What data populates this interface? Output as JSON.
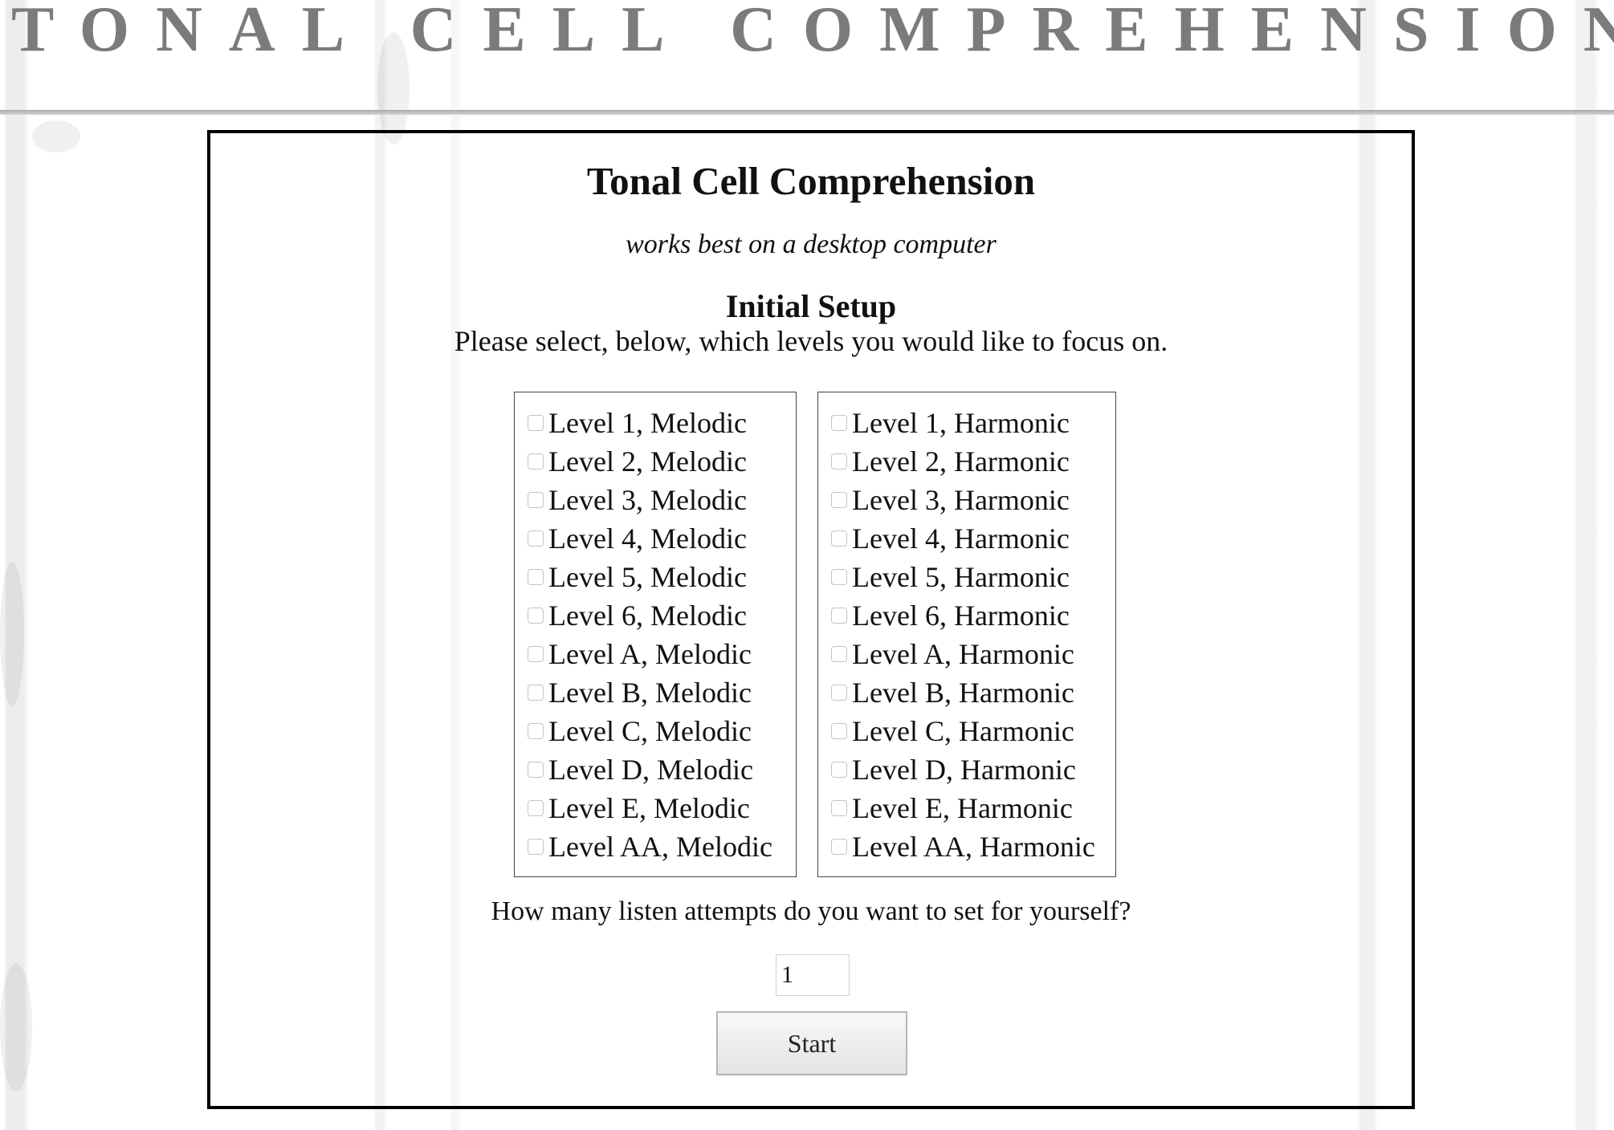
{
  "banner": {
    "title": "TONAL CELL COMPREHENSION"
  },
  "panel": {
    "title": "Tonal Cell Comprehension",
    "subtitle": "works best on a desktop computer",
    "setup_heading": "Initial Setup",
    "instructions": "Please select, below, which levels you would like to focus on."
  },
  "melodic_levels": [
    {
      "label": "Level 1, Melodic",
      "checked": false
    },
    {
      "label": "Level 2, Melodic",
      "checked": false
    },
    {
      "label": "Level 3, Melodic",
      "checked": false
    },
    {
      "label": "Level 4, Melodic",
      "checked": false
    },
    {
      "label": "Level 5, Melodic",
      "checked": false
    },
    {
      "label": "Level 6, Melodic",
      "checked": false
    },
    {
      "label": "Level A, Melodic",
      "checked": false
    },
    {
      "label": "Level B, Melodic",
      "checked": false
    },
    {
      "label": "Level C, Melodic",
      "checked": false
    },
    {
      "label": "Level D, Melodic",
      "checked": false
    },
    {
      "label": "Level E, Melodic",
      "checked": false
    },
    {
      "label": "Level AA, Melodic",
      "checked": false
    }
  ],
  "harmonic_levels": [
    {
      "label": "Level 1, Harmonic",
      "checked": false
    },
    {
      "label": "Level 2, Harmonic",
      "checked": false
    },
    {
      "label": "Level 3, Harmonic",
      "checked": false
    },
    {
      "label": "Level 4, Harmonic",
      "checked": false
    },
    {
      "label": "Level 5, Harmonic",
      "checked": false
    },
    {
      "label": "Level 6, Harmonic",
      "checked": false
    },
    {
      "label": "Level A, Harmonic",
      "checked": false
    },
    {
      "label": "Level B, Harmonic",
      "checked": false
    },
    {
      "label": "Level C, Harmonic",
      "checked": false
    },
    {
      "label": "Level D, Harmonic",
      "checked": false
    },
    {
      "label": "Level E, Harmonic",
      "checked": false
    },
    {
      "label": "Level AA, Harmonic",
      "checked": false
    }
  ],
  "attempts": {
    "question": "How many listen attempts do you want to set for yourself?",
    "value": "1"
  },
  "start_button": {
    "label": "Start"
  },
  "colors": {
    "banner_text": "#7b7b7b",
    "panel_border": "#000000",
    "background": "#ffffff"
  }
}
